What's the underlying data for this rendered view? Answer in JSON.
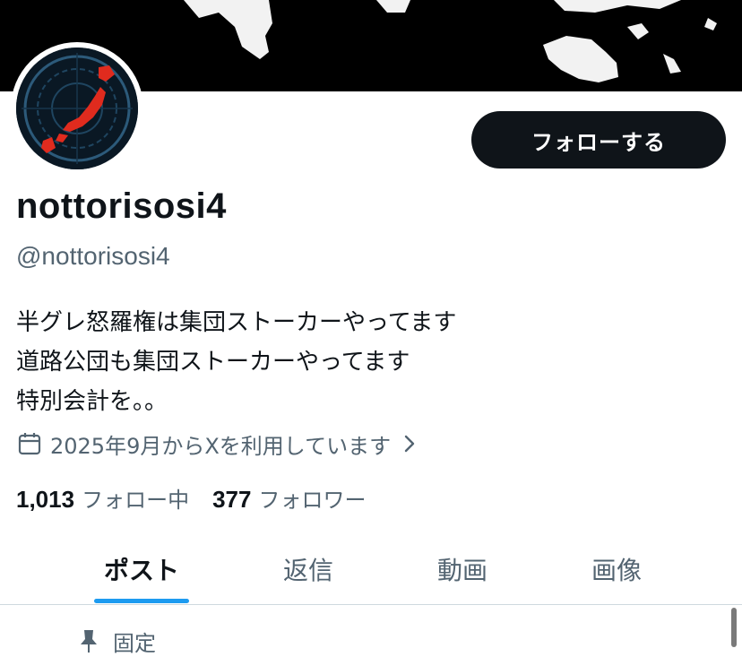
{
  "profile": {
    "display_name": "nottorisosi4",
    "handle": "@nottorisosi4",
    "follow_label": "フォローする",
    "bio_lines": [
      "半グレ怒羅権は集団ストーカーやってます",
      "道路公団も集団ストーカーやってます",
      "特別会計を。。"
    ],
    "joined": "2025年9月からXを利用しています"
  },
  "stats": {
    "following_count": "1,013",
    "following_label": "フォロー中",
    "followers_count": "377",
    "followers_label": "フォロワー"
  },
  "tabs": [
    {
      "label": "ポスト",
      "active": true
    },
    {
      "label": "返信",
      "active": false
    },
    {
      "label": "動画",
      "active": false
    },
    {
      "label": "画像",
      "active": false
    }
  ],
  "pinned": {
    "label": "固定"
  },
  "colors": {
    "accent": "#1d9bf0",
    "text": "#0f1419",
    "muted": "#536471",
    "button": "#0f1419"
  },
  "icons": {
    "joined": "calendar-icon",
    "chevron": "chevron-right-icon",
    "pinned": "pin-icon"
  }
}
